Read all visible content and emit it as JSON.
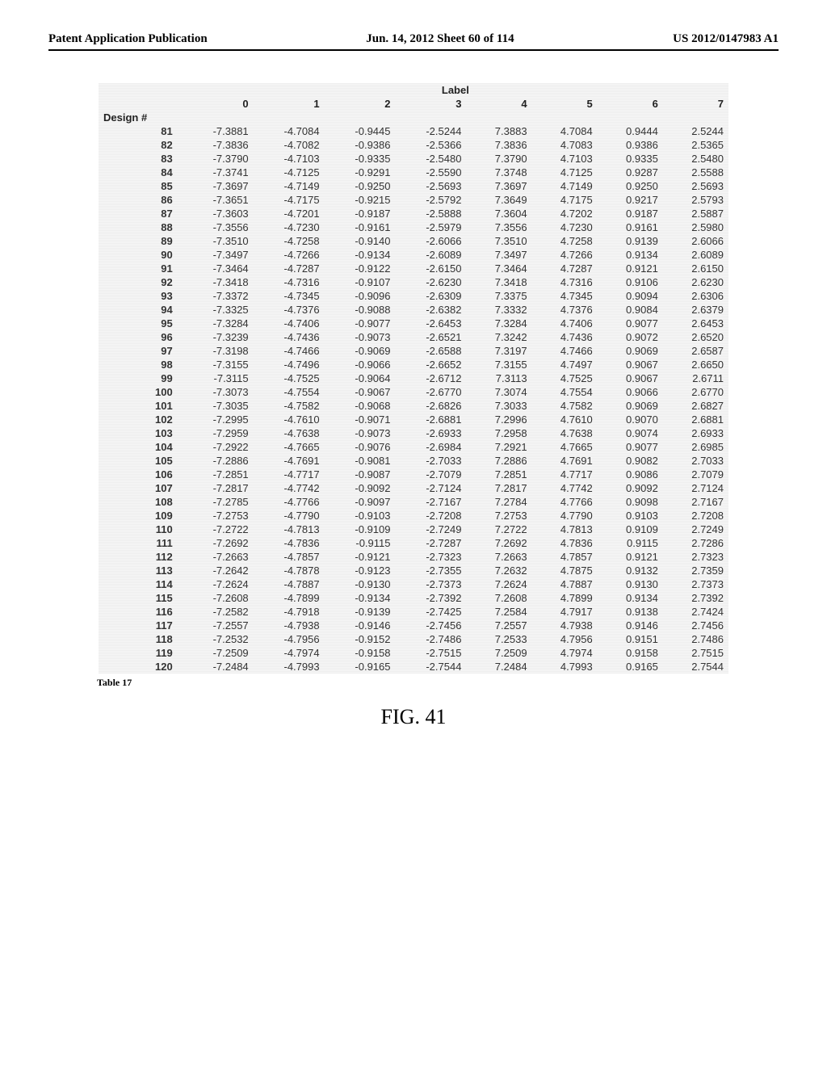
{
  "header": {
    "left": "Patent Application Publication",
    "center": "Jun. 14, 2012  Sheet 60 of 114",
    "right": "US 2012/0147983 A1"
  },
  "table": {
    "super_header": "Label",
    "col_headers": [
      "0",
      "1",
      "2",
      "3",
      "4",
      "5",
      "6",
      "7"
    ],
    "row_label_header": "Design #",
    "rows": [
      {
        "id": "81",
        "v": [
          "-7.3881",
          "-4.7084",
          "-0.9445",
          "-2.5244",
          "7.3883",
          "4.7084",
          "0.9444",
          "2.5244"
        ]
      },
      {
        "id": "82",
        "v": [
          "-7.3836",
          "-4.7082",
          "-0.9386",
          "-2.5366",
          "7.3836",
          "4.7083",
          "0.9386",
          "2.5365"
        ]
      },
      {
        "id": "83",
        "v": [
          "-7.3790",
          "-4.7103",
          "-0.9335",
          "-2.5480",
          "7.3790",
          "4.7103",
          "0.9335",
          "2.5480"
        ]
      },
      {
        "id": "84",
        "v": [
          "-7.3741",
          "-4.7125",
          "-0.9291",
          "-2.5590",
          "7.3748",
          "4.7125",
          "0.9287",
          "2.5588"
        ]
      },
      {
        "id": "85",
        "v": [
          "-7.3697",
          "-4.7149",
          "-0.9250",
          "-2.5693",
          "7.3697",
          "4.7149",
          "0.9250",
          "2.5693"
        ]
      },
      {
        "id": "86",
        "v": [
          "-7.3651",
          "-4.7175",
          "-0.9215",
          "-2.5792",
          "7.3649",
          "4.7175",
          "0.9217",
          "2.5793"
        ]
      },
      {
        "id": "87",
        "v": [
          "-7.3603",
          "-4.7201",
          "-0.9187",
          "-2.5888",
          "7.3604",
          "4.7202",
          "0.9187",
          "2.5887"
        ]
      },
      {
        "id": "88",
        "v": [
          "-7.3556",
          "-4.7230",
          "-0.9161",
          "-2.5979",
          "7.3556",
          "4.7230",
          "0.9161",
          "2.5980"
        ]
      },
      {
        "id": "89",
        "v": [
          "-7.3510",
          "-4.7258",
          "-0.9140",
          "-2.6066",
          "7.3510",
          "4.7258",
          "0.9139",
          "2.6066"
        ]
      },
      {
        "id": "90",
        "v": [
          "-7.3497",
          "-4.7266",
          "-0.9134",
          "-2.6089",
          "7.3497",
          "4.7266",
          "0.9134",
          "2.6089"
        ]
      },
      {
        "id": "91",
        "v": [
          "-7.3464",
          "-4.7287",
          "-0.9122",
          "-2.6150",
          "7.3464",
          "4.7287",
          "0.9121",
          "2.6150"
        ]
      },
      {
        "id": "92",
        "v": [
          "-7.3418",
          "-4.7316",
          "-0.9107",
          "-2.6230",
          "7.3418",
          "4.7316",
          "0.9106",
          "2.6230"
        ]
      },
      {
        "id": "93",
        "v": [
          "-7.3372",
          "-4.7345",
          "-0.9096",
          "-2.6309",
          "7.3375",
          "4.7345",
          "0.9094",
          "2.6306"
        ]
      },
      {
        "id": "94",
        "v": [
          "-7.3325",
          "-4.7376",
          "-0.9088",
          "-2.6382",
          "7.3332",
          "4.7376",
          "0.9084",
          "2.6379"
        ]
      },
      {
        "id": "95",
        "v": [
          "-7.3284",
          "-4.7406",
          "-0.9077",
          "-2.6453",
          "7.3284",
          "4.7406",
          "0.9077",
          "2.6453"
        ]
      },
      {
        "id": "96",
        "v": [
          "-7.3239",
          "-4.7436",
          "-0.9073",
          "-2.6521",
          "7.3242",
          "4.7436",
          "0.9072",
          "2.6520"
        ]
      },
      {
        "id": "97",
        "v": [
          "-7.3198",
          "-4.7466",
          "-0.9069",
          "-2.6588",
          "7.3197",
          "4.7466",
          "0.9069",
          "2.6587"
        ]
      },
      {
        "id": "98",
        "v": [
          "-7.3155",
          "-4.7496",
          "-0.9066",
          "-2.6652",
          "7.3155",
          "4.7497",
          "0.9067",
          "2.6650"
        ]
      },
      {
        "id": "99",
        "v": [
          "-7.3115",
          "-4.7525",
          "-0.9064",
          "-2.6712",
          "7.3113",
          "4.7525",
          "0.9067",
          "2.6711"
        ]
      },
      {
        "id": "100",
        "v": [
          "-7.3073",
          "-4.7554",
          "-0.9067",
          "-2.6770",
          "7.3074",
          "4.7554",
          "0.9066",
          "2.6770"
        ]
      },
      {
        "id": "101",
        "v": [
          "-7.3035",
          "-4.7582",
          "-0.9068",
          "-2.6826",
          "7.3033",
          "4.7582",
          "0.9069",
          "2.6827"
        ]
      },
      {
        "id": "102",
        "v": [
          "-7.2995",
          "-4.7610",
          "-0.9071",
          "-2.6881",
          "7.2996",
          "4.7610",
          "0.9070",
          "2.6881"
        ]
      },
      {
        "id": "103",
        "v": [
          "-7.2959",
          "-4.7638",
          "-0.9073",
          "-2.6933",
          "7.2958",
          "4.7638",
          "0.9074",
          "2.6933"
        ]
      },
      {
        "id": "104",
        "v": [
          "-7.2922",
          "-4.7665",
          "-0.9076",
          "-2.6984",
          "7.2921",
          "4.7665",
          "0.9077",
          "2.6985"
        ]
      },
      {
        "id": "105",
        "v": [
          "-7.2886",
          "-4.7691",
          "-0.9081",
          "-2.7033",
          "7.2886",
          "4.7691",
          "0.9082",
          "2.7033"
        ]
      },
      {
        "id": "106",
        "v": [
          "-7.2851",
          "-4.7717",
          "-0.9087",
          "-2.7079",
          "7.2851",
          "4.7717",
          "0.9086",
          "2.7079"
        ]
      },
      {
        "id": "107",
        "v": [
          "-7.2817",
          "-4.7742",
          "-0.9092",
          "-2.7124",
          "7.2817",
          "4.7742",
          "0.9092",
          "2.7124"
        ]
      },
      {
        "id": "108",
        "v": [
          "-7.2785",
          "-4.7766",
          "-0.9097",
          "-2.7167",
          "7.2784",
          "4.7766",
          "0.9098",
          "2.7167"
        ]
      },
      {
        "id": "109",
        "v": [
          "-7.2753",
          "-4.7790",
          "-0.9103",
          "-2.7208",
          "7.2753",
          "4.7790",
          "0.9103",
          "2.7208"
        ]
      },
      {
        "id": "110",
        "v": [
          "-7.2722",
          "-4.7813",
          "-0.9109",
          "-2.7249",
          "7.2722",
          "4.7813",
          "0.9109",
          "2.7249"
        ]
      },
      {
        "id": "111",
        "v": [
          "-7.2692",
          "-4.7836",
          "-0.9115",
          "-2.7287",
          "7.2692",
          "4.7836",
          "0.9115",
          "2.7286"
        ]
      },
      {
        "id": "112",
        "v": [
          "-7.2663",
          "-4.7857",
          "-0.9121",
          "-2.7323",
          "7.2663",
          "4.7857",
          "0.9121",
          "2.7323"
        ]
      },
      {
        "id": "113",
        "v": [
          "-7.2642",
          "-4.7878",
          "-0.9123",
          "-2.7355",
          "7.2632",
          "4.7875",
          "0.9132",
          "2.7359"
        ]
      },
      {
        "id": "114",
        "v": [
          "-7.2624",
          "-4.7887",
          "-0.9130",
          "-2.7373",
          "7.2624",
          "4.7887",
          "0.9130",
          "2.7373"
        ]
      },
      {
        "id": "115",
        "v": [
          "-7.2608",
          "-4.7899",
          "-0.9134",
          "-2.7392",
          "7.2608",
          "4.7899",
          "0.9134",
          "2.7392"
        ]
      },
      {
        "id": "116",
        "v": [
          "-7.2582",
          "-4.7918",
          "-0.9139",
          "-2.7425",
          "7.2584",
          "4.7917",
          "0.9138",
          "2.7424"
        ]
      },
      {
        "id": "117",
        "v": [
          "-7.2557",
          "-4.7938",
          "-0.9146",
          "-2.7456",
          "7.2557",
          "4.7938",
          "0.9146",
          "2.7456"
        ]
      },
      {
        "id": "118",
        "v": [
          "-7.2532",
          "-4.7956",
          "-0.9152",
          "-2.7486",
          "7.2533",
          "4.7956",
          "0.9151",
          "2.7486"
        ]
      },
      {
        "id": "119",
        "v": [
          "-7.2509",
          "-4.7974",
          "-0.9158",
          "-2.7515",
          "7.2509",
          "4.7974",
          "0.9158",
          "2.7515"
        ]
      },
      {
        "id": "120",
        "v": [
          "-7.2484",
          "-4.7993",
          "-0.9165",
          "-2.7544",
          "7.2484",
          "4.7993",
          "0.9165",
          "2.7544"
        ]
      }
    ]
  },
  "caption": "Table 17",
  "figure_label": "FIG. 41",
  "chart_data": {
    "type": "table",
    "title": "Label",
    "row_key": "Design #",
    "columns": [
      "0",
      "1",
      "2",
      "3",
      "4",
      "5",
      "6",
      "7"
    ],
    "rows_range": [
      81,
      120
    ]
  }
}
